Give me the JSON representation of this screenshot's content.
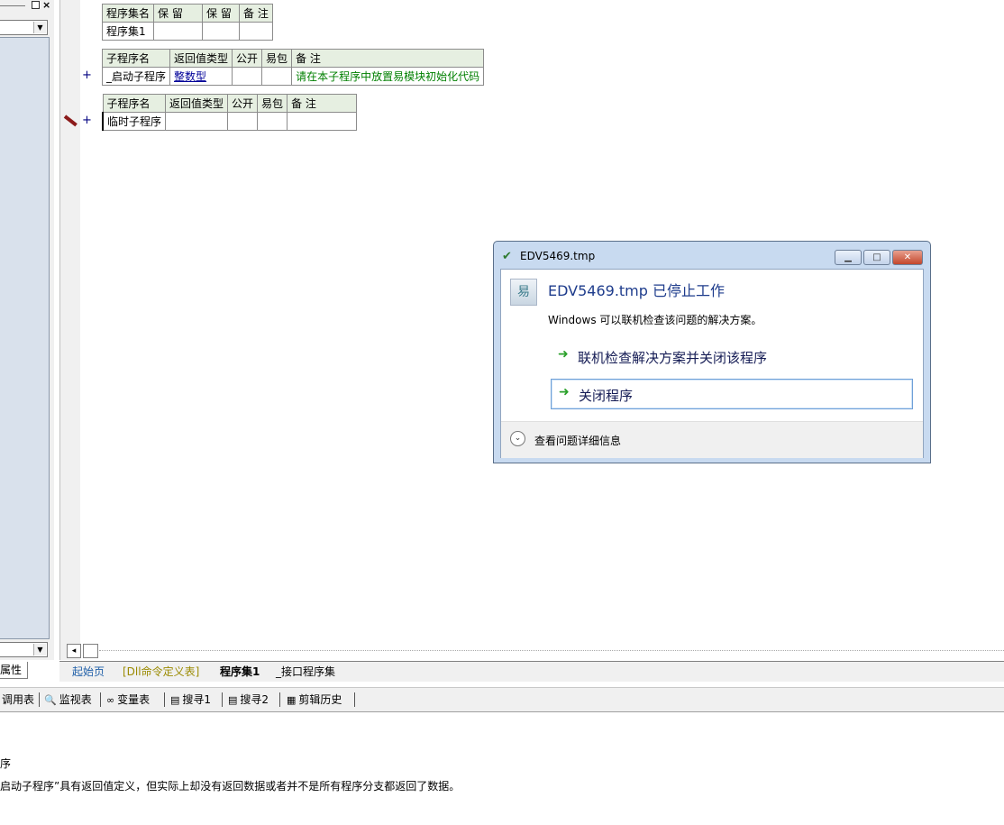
{
  "left_panel": {
    "pin_icon": "pin-icon",
    "close_glyph": "×",
    "combo_arrow": "▼",
    "property_tab_label": "属性"
  },
  "assembly_table": {
    "headers": [
      "程序集名",
      "保 留",
      "保 留",
      "备 注"
    ],
    "row": [
      "程序集1",
      "",
      "",
      ""
    ]
  },
  "sub_table_1": {
    "headers": [
      "子程序名",
      "返回值类型",
      "公开",
      "易包",
      "备 注"
    ],
    "row": [
      "_启动子程序",
      "整数型",
      "",
      "",
      "请在本子程序中放置易模块初始化代码"
    ]
  },
  "sub_table_2": {
    "headers": [
      "子程序名",
      "返回值类型",
      "公开",
      "易包",
      "备 注"
    ],
    "row": [
      "临时子程序",
      "",
      "",
      "",
      ""
    ]
  },
  "gutter": {
    "plus": "+"
  },
  "hscroll": {
    "left_arrow": "◂"
  },
  "tabs": [
    {
      "label": "起始页",
      "color": "#00008b"
    },
    {
      "label": "[Dll命令定义表]",
      "color": "#8b8b00"
    },
    {
      "label": "程序集1",
      "color": "#000000",
      "active": true
    },
    {
      "label": "_接口程序集",
      "color": "#000000"
    }
  ],
  "toolbar": {
    "items": [
      "调用表",
      "监视表",
      "变量表",
      "搜寻1",
      "搜寻2",
      "剪辑历史"
    ]
  },
  "output": {
    "line1": "序",
    "line2": "启动子程序”具有返回值定义，但实际上却没有返回数据或者并不是所有程序分支都返回了数据。"
  },
  "dialog": {
    "title": "EDV5469.tmp",
    "heading": "EDV5469.tmp 已停止工作",
    "subtext": "Windows 可以联机检查该问题的解决方案。",
    "option1": "联机检查解决方案并关闭该程序",
    "option2": "关闭程序",
    "details": "查看问题详细信息",
    "btn_min": "▁",
    "btn_max": "□",
    "btn_close": "✕",
    "arrow_glyph": "➜",
    "expand_glyph": "⌄"
  }
}
